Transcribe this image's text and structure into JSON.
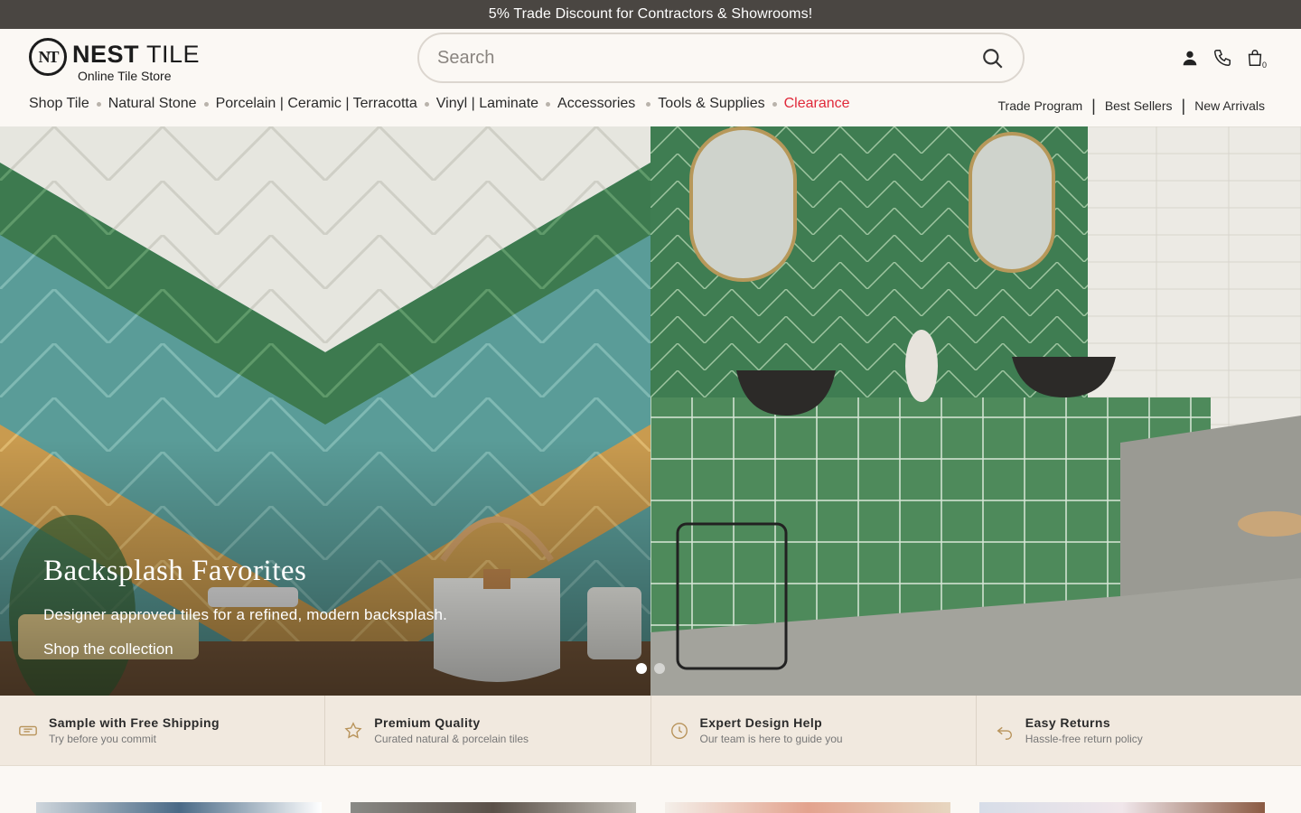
{
  "announcement": "5% Trade Discount for Contractors & Showrooms!",
  "logo": {
    "mark": "NT",
    "word_bold": "NEST",
    "word_light": "TILE",
    "tagline": "Online Tile Store"
  },
  "search": {
    "placeholder": "Search",
    "value": ""
  },
  "utility": {
    "cart_count": "0"
  },
  "nav": {
    "items": [
      "Shop Tile",
      "Natural Stone",
      "Porcelain | Ceramic | Terracotta",
      "Vinyl | Laminate",
      "Accessories",
      "Tools & Supplies",
      "Clearance"
    ]
  },
  "secondary_nav": [
    "Trade Program",
    "Best Sellers",
    "New Arrivals"
  ],
  "hero": {
    "title": "Backsplash Favorites",
    "subtitle": "Designer approved tiles for a refined, modern backsplash.",
    "cta": "Shop the collection",
    "active_slide": 1,
    "slide_count": 2
  },
  "features": [
    {
      "title": "Sample with Free Shipping",
      "subtitle": "Try before you commit",
      "icon": "ticket-icon"
    },
    {
      "title": "Premium Quality",
      "subtitle": "Curated natural & porcelain tiles",
      "icon": "star-icon"
    },
    {
      "title": "Expert Design Help",
      "subtitle": "Our team is here to guide you",
      "icon": "clock-icon"
    },
    {
      "title": "Easy Returns",
      "subtitle": "Hassle-free return policy",
      "icon": "return-arrow-icon"
    }
  ],
  "colors": {
    "announcement_bg": "#4a4642",
    "page_bg": "#fbf8f4",
    "features_bg": "#f1e9df",
    "sale": "#e0293a"
  }
}
